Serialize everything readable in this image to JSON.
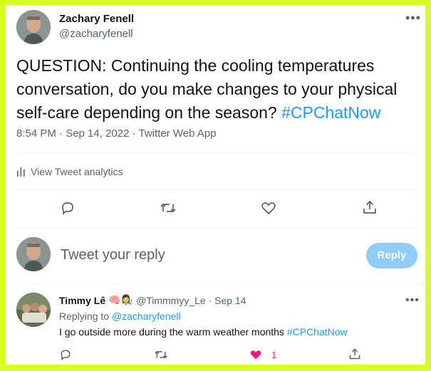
{
  "tweet": {
    "author_name": "Zachary Fenell",
    "author_handle": "@zacharyfenell",
    "more_icon": "more-horizontal-icon",
    "text_main": "QUESTION: Continuing the cooling temperatures conversation, do you make changes to your physical self-care depending on the season?",
    "hashtag": "#CPChatNow",
    "timestamp": "8:54 PM · Sep 14, 2022 · Twitter Web App",
    "analytics_label": "View Tweet analytics",
    "actions": [
      "reply-icon",
      "retweet-icon",
      "like-icon",
      "share-icon"
    ]
  },
  "composer": {
    "placeholder": "Tweet your reply",
    "button_label": "Reply"
  },
  "reply": {
    "author_name": "Timmy Lê",
    "emojis": "🧠👩‍🔬",
    "handle_time": "@Timmmyy_Le · Sep 14",
    "replying_to_prefix": "Replying to",
    "replying_to_handle": "@zacharyfenell",
    "text_main": "I go outside more during the warm weather months",
    "hashtag": "#CPChatNow",
    "like_count": "1"
  },
  "colors": {
    "border": "#d7ff1c",
    "accent": "#1d9bf0",
    "like": "#f91880",
    "muted": "#536471"
  }
}
